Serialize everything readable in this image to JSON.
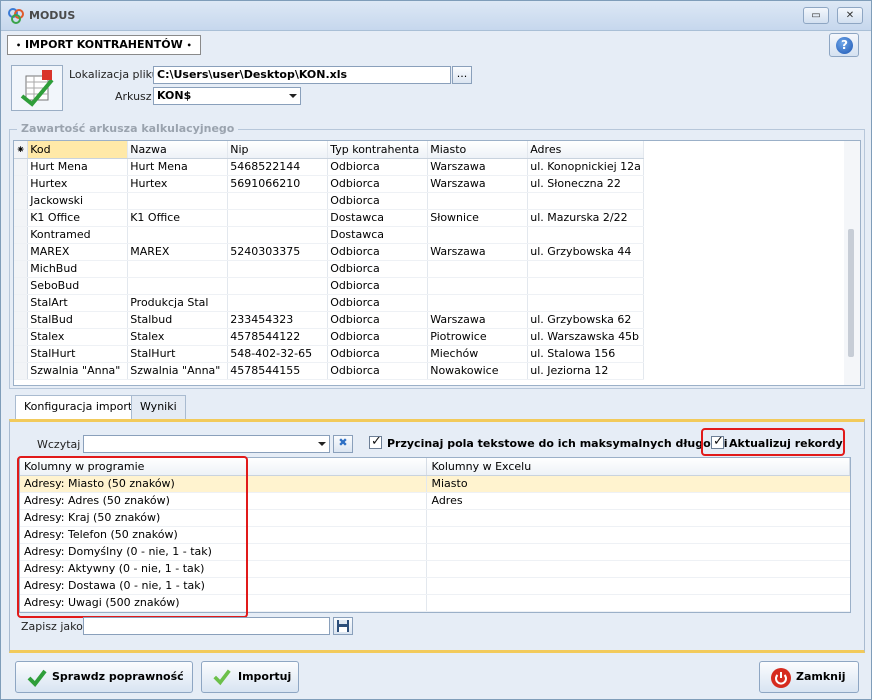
{
  "app": {
    "title": "MODUS"
  },
  "window_controls": {
    "restore": "▭",
    "close": "✕"
  },
  "doc_tab": {
    "label": "IMPORT KONTRAHENTÓW",
    "help": "?"
  },
  "file": {
    "location_label": "Lokalizacja pliku",
    "location_value": "C:\\Users\\user\\Desktop\\KON.xls",
    "browse_label": "...",
    "sheet_label": "Arkusz",
    "sheet_value": "KON$"
  },
  "sheet_group": {
    "title": "Zawartość arkusza kalkulacyjnego",
    "columns": [
      "Kod",
      "Nazwa",
      "Nip",
      "Typ kontrahenta",
      "Miasto",
      "Adres"
    ],
    "rows": [
      [
        "Hurt Mena",
        "Hurt Mena",
        "5468522144",
        "Odbiorca",
        "Warszawa",
        "ul. Konopnickiej 12a"
      ],
      [
        "Hurtex",
        "Hurtex",
        "5691066210",
        "Odbiorca",
        "Warszawa",
        "ul. Słoneczna 22"
      ],
      [
        "Jackowski",
        "",
        "",
        "Odbiorca",
        "",
        ""
      ],
      [
        "K1 Office",
        "K1 Office",
        "",
        "Dostawca",
        "Słownice",
        "ul. Mazurska 2/22"
      ],
      [
        "Kontramed",
        "",
        "",
        "Dostawca",
        "",
        ""
      ],
      [
        "MAREX",
        "MAREX",
        "5240303375",
        "Odbiorca",
        "Warszawa",
        "ul. Grzybowska 44"
      ],
      [
        "MichBud",
        "",
        "",
        "Odbiorca",
        "",
        ""
      ],
      [
        "SeboBud",
        "",
        "",
        "Odbiorca",
        "",
        ""
      ],
      [
        "StalArt",
        "Produkcja Stal",
        "",
        "Odbiorca",
        "",
        ""
      ],
      [
        "StalBud",
        "Stalbud",
        "233454323",
        "Odbiorca",
        "Warszawa",
        "ul. Grzybowska 62"
      ],
      [
        "Stalex",
        "Stalex",
        "4578544122",
        "Odbiorca",
        "Piotrowice",
        "ul. Warszawska 45b"
      ],
      [
        "StalHurt",
        "StalHurt",
        "548-402-32-65",
        "Odbiorca",
        "Miechów",
        "ul. Stalowa 156"
      ],
      [
        "Szwalnia \"Anna\"",
        "Szwalnia \"Anna\"",
        "4578544155",
        "Odbiorca",
        "Nowakowice",
        "ul. Jeziorna 12"
      ]
    ]
  },
  "tabs": [
    {
      "label": "Konfiguracja importu",
      "active": true
    },
    {
      "label": "Wyniki",
      "active": false
    }
  ],
  "config": {
    "load_label": "Wczytaj",
    "load_value": "",
    "trim_label": "Przycinaj pola tekstowe do ich maksymalnych długości",
    "trim_checked": true,
    "update_label": "Aktualizuj rekordy",
    "update_checked": true,
    "mapping_columns": [
      "Kolumny w programie",
      "Kolumny w Excelu"
    ],
    "mapping_rows": [
      [
        "Adresy: Miasto (50 znaków)",
        "Miasto"
      ],
      [
        "Adresy: Adres (50 znaków)",
        "Adres"
      ],
      [
        "Adresy: Kraj (50 znaków)",
        ""
      ],
      [
        "Adresy: Telefon (50 znaków)",
        ""
      ],
      [
        "Adresy: Domyślny (0 - nie, 1 - tak)",
        ""
      ],
      [
        "Adresy: Aktywny (0 - nie, 1 - tak)",
        ""
      ],
      [
        "Adresy: Dostawa (0 - nie, 1 - tak)",
        ""
      ],
      [
        "Adresy: Uwagi (500 znaków)",
        ""
      ]
    ],
    "save_as_label": "Zapisz jako",
    "save_as_value": ""
  },
  "buttons": {
    "validate": "Sprawdz poprawność",
    "import": "Importuj",
    "close": "Zamknij"
  },
  "colors": {
    "highlight": "#e11a1a",
    "accent": "#f2ca5b",
    "selected_row": "#fff3cf"
  }
}
